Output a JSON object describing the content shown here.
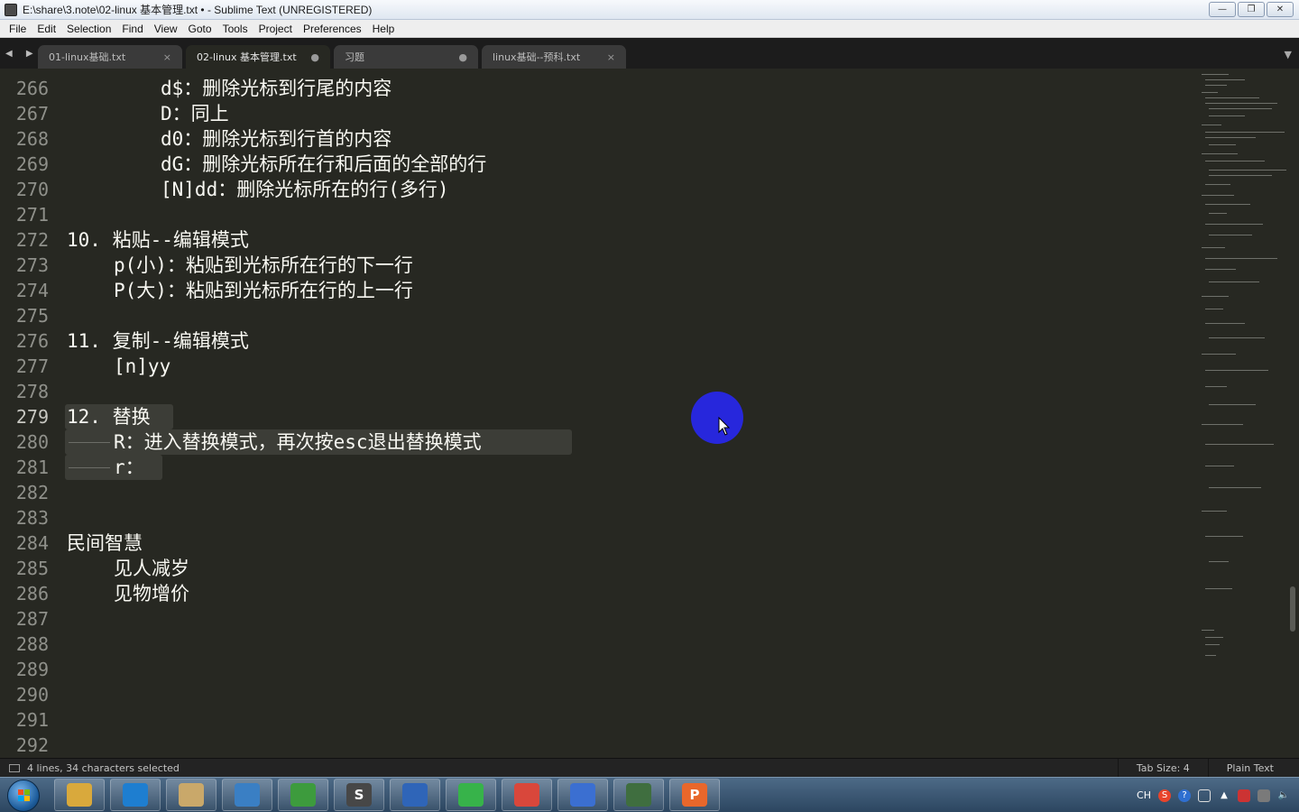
{
  "window": {
    "title": "E:\\share\\3.note\\02-linux 基本管理.txt • - Sublime Text (UNREGISTERED)",
    "minimize": "—",
    "restore": "❐",
    "close": "✕"
  },
  "menu": [
    "File",
    "Edit",
    "Selection",
    "Find",
    "View",
    "Goto",
    "Tools",
    "Project",
    "Preferences",
    "Help"
  ],
  "tabs": [
    {
      "label": "01-linux基础.txt",
      "control": "×"
    },
    {
      "label": "02-linux 基本管理.txt",
      "control": "●"
    },
    {
      "label": "习题",
      "control": "●"
    },
    {
      "label": "linux基础--预科.txt",
      "control": "×"
    }
  ],
  "tab_nav": "◀ ▶",
  "tab_dropdown": "▼",
  "editor": {
    "line_numbers": [
      "266",
      "267",
      "268",
      "269",
      "270",
      "271",
      "272",
      "273",
      "274",
      "275",
      "276",
      "277",
      "278",
      "279",
      "280",
      "281",
      "282",
      "283",
      "284",
      "285",
      "286",
      "287",
      "288",
      "289",
      "290",
      "291",
      "292"
    ],
    "current_line": "279",
    "lines": [
      {
        "text": "d$：删除光标到行尾的内容"
      },
      {
        "text": "D：同上"
      },
      {
        "text": "d0：删除光标到行首的内容"
      },
      {
        "text": "dG：删除光标所在行和后面的全部的行"
      },
      {
        "text": "[N]dd：删除光标所在的行(多行)"
      },
      {
        "text": ""
      },
      {
        "text": "10. 粘贴--编辑模式"
      },
      {
        "text": "p(小)：粘贴到光标所在行的下一行"
      },
      {
        "text": "P(大)：粘贴到光标所在行的上一行"
      },
      {
        "text": ""
      },
      {
        "text": "11. 复制--编辑模式"
      },
      {
        "text": "[n]yy"
      },
      {
        "text": ""
      },
      {
        "text": "12. 替换"
      },
      {
        "text": "R：进入替换模式，再次按esc退出替换模式"
      },
      {
        "text": "r："
      },
      {
        "text": ""
      },
      {
        "text": ""
      },
      {
        "text": "民间智慧"
      },
      {
        "text": "见人减岁"
      },
      {
        "text": "见物增价"
      }
    ]
  },
  "status": {
    "selection": "4 lines, 34 characters selected",
    "tab_size": "Tab Size: 4",
    "syntax": "Plain Text"
  },
  "taskbar": {
    "apps": [
      {
        "icon": "file-explorer-icon",
        "color": "#d9a93c"
      },
      {
        "icon": "browser-icon",
        "color": "#1e7ed0"
      },
      {
        "icon": "paint-icon",
        "color": "#c9a86a"
      },
      {
        "icon": "image-viewer-icon",
        "color": "#3a7fc4"
      },
      {
        "icon": "network-tool-icon",
        "color": "#3d9b3d"
      },
      {
        "icon": "sublime-text-icon",
        "color": "#474747",
        "glyph": "S"
      },
      {
        "icon": "remote-desktop-icon",
        "color": "#2f65b8"
      },
      {
        "icon": "sync-icon",
        "color": "#37b34a"
      },
      {
        "icon": "media-player-icon",
        "color": "#d9473b"
      },
      {
        "icon": "archive-icon",
        "color": "#3b6fd1"
      },
      {
        "icon": "terminal-icon",
        "color": "#3f6e3f"
      },
      {
        "icon": "presentation-icon",
        "color": "#e8672b",
        "glyph": "P"
      }
    ],
    "tray": {
      "ime": "CH",
      "sogou": "S",
      "help": "?"
    }
  }
}
